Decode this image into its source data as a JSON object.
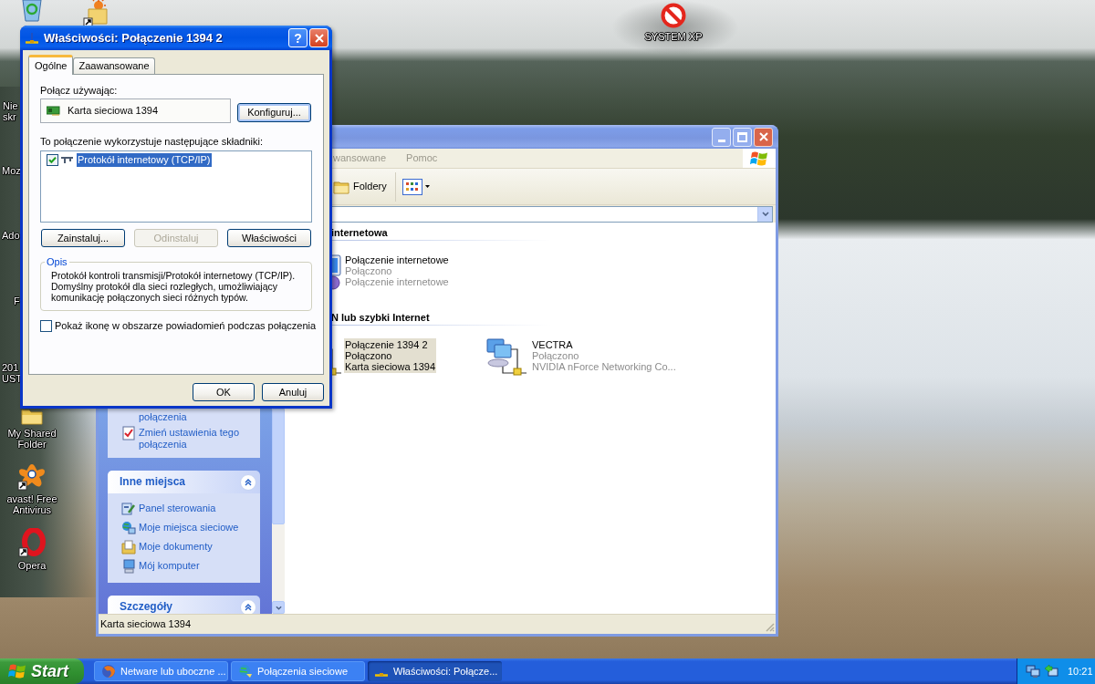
{
  "desktop_icons": [
    {
      "kind": "none",
      "lines": [
        "Nie",
        "skr"
      ]
    },
    {
      "kind": "none",
      "lines": [
        "Moz"
      ]
    },
    {
      "kind": "none",
      "lines": [
        "Ado"
      ]
    },
    {
      "kind": "none",
      "lines": [
        "F"
      ]
    },
    {
      "kind": "none",
      "lines": [
        "201",
        "UST"
      ]
    },
    {
      "kind": "folder",
      "lines": [
        "My Shared",
        "Folder"
      ]
    },
    {
      "kind": "antivirus",
      "lines": [
        "avast! Free",
        "Antivirus"
      ]
    },
    {
      "kind": "browser",
      "lines": [
        "Opera"
      ]
    },
    {
      "kind": "stop",
      "lines": [
        "SYSTEM XP"
      ]
    }
  ],
  "explorer": {
    "menu": [
      "wansowane",
      "Pomoc"
    ],
    "toolbar": {
      "folders": "Foldery"
    },
    "task_pane": [
      {
        "items": [
          {
            "kind": "continued",
            "text": "połączenia"
          },
          {
            "kind": "settings",
            "text": "Zmień ustawienia tego połączenia"
          }
        ]
      },
      {
        "title": "Inne miejsca",
        "expanded": true,
        "items": [
          {
            "kind": "control-panel",
            "text": "Panel sterowania"
          },
          {
            "kind": "network",
            "text": "Moje miejsca sieciowe"
          },
          {
            "kind": "documents",
            "text": "Moje dokumenty"
          },
          {
            "kind": "computer",
            "text": "Mój komputer"
          }
        ]
      },
      {
        "title": "Szczegóły",
        "expanded": true
      }
    ],
    "groups": [
      {
        "title": "internetowa",
        "items": [
          {
            "kind": "internet",
            "name": "Połączenie internetowe",
            "status": "Połączono",
            "device": "Połączenie internetowe",
            "selected": false
          }
        ]
      },
      {
        "title": "N lub szybki Internet",
        "items": [
          {
            "kind": "lan",
            "name": "Połączenie 1394 2",
            "status": "Połączono",
            "device": "Karta sieciowa 1394",
            "selected": true
          },
          {
            "kind": "lan",
            "name": "VECTRA",
            "status": "Połączono",
            "device": "NVIDIA nForce Networking Co...",
            "selected": false
          }
        ]
      }
    ],
    "status_bar": "Karta sieciowa 1394"
  },
  "dialog": {
    "title": "Właściwości: Połączenie 1394 2",
    "help_button": "?",
    "tabs": [
      {
        "label": "Ogólne",
        "selected": true
      },
      {
        "label": "Zaawansowane",
        "selected": false
      }
    ],
    "connect_using_label": "Połącz używając:",
    "adapter": "Karta sieciowa 1394",
    "configure_button": "Konfiguruj...",
    "components_label": "To połączenie wykorzystuje następujące składniki:",
    "components": [
      {
        "name": "Protokół internetowy (TCP/IP)",
        "checked": true,
        "selected": true
      }
    ],
    "component_buttons": [
      {
        "label": "Zainstaluj...",
        "disabled": false
      },
      {
        "label": "Odinstaluj",
        "disabled": true
      },
      {
        "label": "Właściwości",
        "disabled": false
      }
    ],
    "description": {
      "title": "Opis",
      "lines": [
        "Protokół kontroli transmisji/Protokół internetowy (TCP/IP).",
        "Domyślny protokół dla sieci rozległych, umożliwiający",
        "komunikację połączonych sieci różnych typów."
      ]
    },
    "notify_checkbox": {
      "label": "Pokaż ikonę w obszarze powiadomień podczas połączenia",
      "checked": false
    },
    "buttons": [
      "OK",
      "Anuluj"
    ]
  },
  "taskbar": {
    "start": "Start",
    "tasks": [
      {
        "kind": "browser",
        "label": "Netware lub uboczne ...",
        "selected": false
      },
      {
        "kind": "network",
        "label": "Połączenia sieciowe",
        "selected": false
      },
      {
        "kind": "connection",
        "label": "Właściwości: Połącze...",
        "selected": true
      }
    ],
    "clock": "10:21"
  }
}
